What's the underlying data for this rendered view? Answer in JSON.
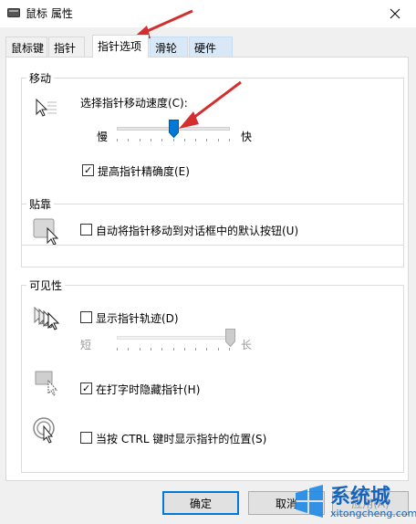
{
  "window": {
    "title": "鼠标 属性"
  },
  "tabs": [
    {
      "label": "鼠标键"
    },
    {
      "label": "指针"
    },
    {
      "label": "指针选项"
    },
    {
      "label": "滑轮"
    },
    {
      "label": "硬件"
    }
  ],
  "motion": {
    "title": "移动",
    "speed_label": "选择指针移动速度(C):",
    "slow": "慢",
    "fast": "快",
    "speed_level": 0.5,
    "precision_label": "提高指针精确度(E)",
    "precision_checked": true
  },
  "snap": {
    "title": "贴靠",
    "label": "自动将指针移动到对话框中的默认按钮(U)",
    "checked": false
  },
  "visibility": {
    "title": "可见性",
    "trails_label": "显示指针轨迹(D)",
    "trails_checked": false,
    "short": "短",
    "long": "长",
    "trail_level": 1.0,
    "hide_label": "在打字时隐藏指针(H)",
    "hide_checked": true,
    "show_location_label": "当按 CTRL 键时显示指针的位置(S)",
    "show_location_checked": false
  },
  "buttons": {
    "ok": "确定",
    "cancel": "取消",
    "apply": "应用(A)"
  },
  "watermark": {
    "brand": "系统城",
    "url": "xitongcheng.com"
  },
  "colors": {
    "accent": "#0078d7",
    "annotation_arrow": "#d32f2f"
  }
}
